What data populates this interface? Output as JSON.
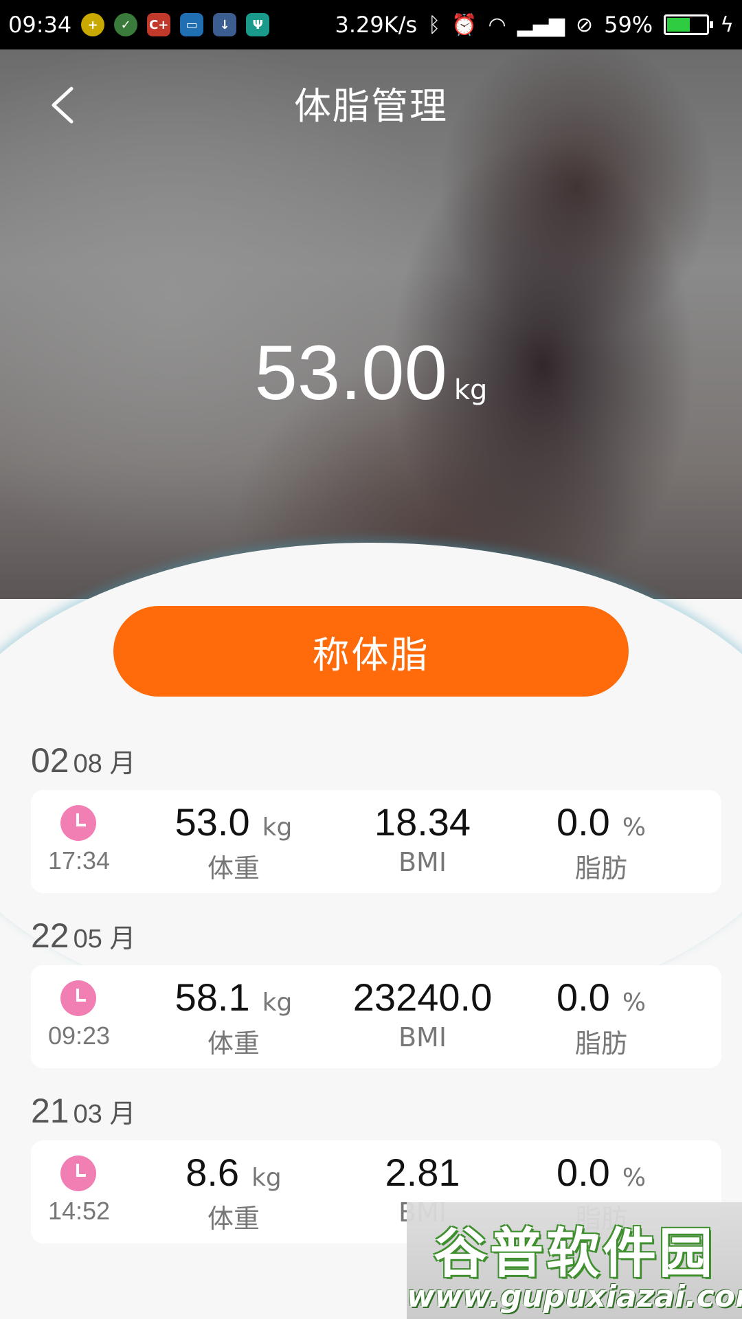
{
  "status_bar": {
    "time": "09:34",
    "network_speed": "3.29K/s",
    "battery": "59%",
    "battery_level": 0.59,
    "notification_icons": [
      "add-icon",
      "check-icon",
      "c-plus-icon",
      "message-icon",
      "download-icon",
      "usb-icon"
    ],
    "status_icons": [
      "bluetooth-icon",
      "alarm-icon",
      "wifi-icon",
      "signal-icon",
      "no-disturb-icon"
    ]
  },
  "header": {
    "title": "体脂管理",
    "back_icon": "chevron-left-icon"
  },
  "summary": {
    "weight": "53.00",
    "unit": "kg"
  },
  "weigh_button": {
    "label": "称体脂",
    "color": "#ff6a0b"
  },
  "records": [
    {
      "day": "02",
      "month": "08 月",
      "time": "17:34",
      "weight": "53.0",
      "weight_unit": "kg",
      "weight_label": "体重",
      "bmi": "18.34",
      "bmi_label": "BMI",
      "fat": "0.0",
      "fat_unit": "%",
      "fat_label": "脂肪"
    },
    {
      "day": "22",
      "month": "05 月",
      "time": "09:23",
      "weight": "58.1",
      "weight_unit": "kg",
      "weight_label": "体重",
      "bmi": "23240.0",
      "bmi_label": "BMI",
      "fat": "0.0",
      "fat_unit": "%",
      "fat_label": "脂肪"
    },
    {
      "day": "21",
      "month": "03 月",
      "time": "14:52",
      "weight": "8.6",
      "weight_unit": "kg",
      "weight_label": "体重",
      "bmi": "2.81",
      "bmi_label": "BMI",
      "fat": "0.0",
      "fat_unit": "%",
      "fat_label": "脂肪"
    }
  ],
  "watermark": {
    "brand": "谷普软件园",
    "url": "www.gupuxiazai.com"
  },
  "colors": {
    "accent": "#ff6a0b",
    "clock": "#f27fb3"
  }
}
